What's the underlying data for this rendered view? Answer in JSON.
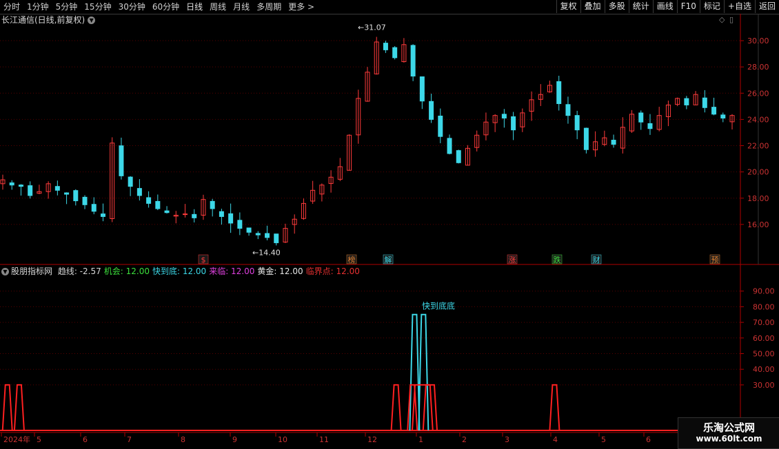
{
  "toolbar": {
    "periods": [
      "分时",
      "1分钟",
      "5分钟",
      "15分钟",
      "30分钟",
      "60分钟",
      "日线",
      "周线",
      "月线",
      "多周期",
      "更多 >"
    ],
    "active_period": "日线",
    "buttons": [
      "复权",
      "叠加",
      "多股",
      "统计",
      "画线",
      "F10",
      "标记",
      "+自选",
      "返回"
    ]
  },
  "main_chart": {
    "title": "长江通信(日线,前复权)",
    "high_label": "31.07",
    "low_label": "14.40",
    "events": [
      "$",
      "榜",
      "解",
      "涨",
      "跌",
      "财",
      "预"
    ]
  },
  "indicator": {
    "name": "股朋指标网",
    "items": [
      {
        "label": "趋线:",
        "value": "-2.57",
        "color": "#d8d8d8"
      },
      {
        "label": "机会:",
        "value": "12.00",
        "color": "#3ce03c"
      },
      {
        "label": "快到底:",
        "value": "12.00",
        "color": "#3cd8e8"
      },
      {
        "label": "来临:",
        "value": "12.00",
        "color": "#e040e0"
      },
      {
        "label": "黄金:",
        "value": "12.00",
        "color": "#e8e8e8"
      },
      {
        "label": "临界点:",
        "value": "12.00",
        "color": "#e83030"
      }
    ],
    "annotation": "快到底底"
  },
  "time_axis": [
    "2024年",
    "5",
    "6",
    "7",
    "8",
    "9",
    "10",
    "11",
    "12",
    "1",
    "2",
    "3",
    "4",
    "5",
    "6"
  ],
  "watermark": {
    "line1": "乐淘公式网",
    "line2": "www.60lt.com"
  },
  "colors": {
    "up": "#ff3b3b",
    "down": "#3dd8e8",
    "grid": "#5a0000",
    "axis": "#b00000"
  },
  "chart_data": {
    "type": "candlestick",
    "price_axis": {
      "min": 14,
      "max": 31,
      "ticks": [
        16.0,
        18.0,
        20.0,
        22.0,
        24.0,
        26.0,
        28.0,
        30.0
      ]
    },
    "indicator_axis": {
      "min": 0,
      "max": 100,
      "ticks": [
        30.0,
        40.0,
        50.0,
        60.0,
        70.0,
        80.0,
        90.0
      ]
    },
    "high": 31.07,
    "low": 14.4,
    "approx_closes": [
      19.4,
      19.0,
      18.9,
      18.2,
      18.5,
      19.1,
      18.6,
      18.3,
      17.8,
      17.5,
      17.0,
      16.6,
      22.2,
      19.7,
      18.9,
      18.2,
      17.6,
      17.2,
      16.9,
      16.7,
      16.8,
      16.5,
      17.9,
      17.2,
      16.6,
      16.1,
      15.7,
      15.4,
      15.2,
      15.0,
      14.6,
      15.7,
      16.4,
      17.6,
      18.6,
      19.0,
      19.6,
      20.4,
      22.8,
      25.6,
      27.6,
      29.9,
      29.3,
      28.7,
      29.7,
      27.3,
      25.4,
      24.0,
      22.7,
      21.4,
      20.7,
      21.8,
      22.8,
      23.8,
      24.3,
      24.1,
      23.2,
      24.5,
      25.5,
      25.9,
      26.6,
      25.2,
      24.3,
      23.2,
      21.7,
      22.3,
      22.6,
      22.1,
      23.4,
      24.4,
      23.8,
      23.3,
      24.3,
      25.1,
      25.6,
      25.1,
      25.9,
      24.9,
      24.4,
      24.1,
      24.3
    ],
    "indicator_spikes": [
      {
        "pos": 0.01,
        "value": 30,
        "color": "red"
      },
      {
        "pos": 0.026,
        "value": 30,
        "color": "red"
      },
      {
        "pos": 0.535,
        "value": 30,
        "color": "red"
      },
      {
        "pos": 0.56,
        "value": 75,
        "color": "cyan"
      },
      {
        "pos": 0.572,
        "value": 75,
        "color": "cyan"
      },
      {
        "pos": 0.557,
        "value": 30,
        "color": "red"
      },
      {
        "pos": 0.578,
        "value": 30,
        "color": "red"
      },
      {
        "pos": 0.749,
        "value": 30,
        "color": "red"
      }
    ]
  }
}
